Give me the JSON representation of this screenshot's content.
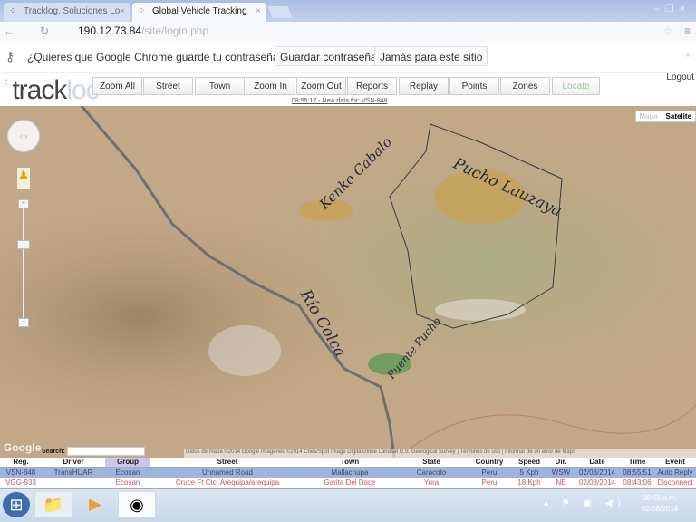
{
  "browser": {
    "tabs": [
      {
        "label": "Tracklog. Soluciones Lo"
      },
      {
        "label": "Global Vehicle Tracking"
      }
    ],
    "url_host": "190.12.73.84",
    "url_path": "/site/login.php",
    "infobar": {
      "question": "¿Quieres que Google Chrome guarde tu contraseña?",
      "save": "Guardar contraseña",
      "never": "Jamás para este sitio"
    }
  },
  "app": {
    "logo": "trackloc",
    "nav": [
      "Zoom All",
      "Street",
      "Town",
      "Zoom In",
      "Zoom Out",
      "Reports",
      "Replay",
      "Points",
      "Zones",
      "Locate"
    ],
    "logout": "Logout",
    "status": "08:55:17 - New data for: VSN-848"
  },
  "map": {
    "types": [
      "Mapa",
      "Satelite"
    ],
    "google": "Google",
    "search_label": "Search:",
    "copyright": "Datos de mapa ©2014 Google Imágenes ©2014 Cnes/Spot Image DigitalGlobe Landsat U.S. Geological Survey | Términos de uso | Informar de un error de Maps",
    "annotations": [
      "Kenko Cabalo",
      "Pucho Lauzaya",
      "Río Colca",
      "Puente Pucho"
    ]
  },
  "table": {
    "columns": [
      "Reg.",
      "Driver",
      "Group",
      "Street",
      "Town",
      "State",
      "Country",
      "Speed",
      "Dir.",
      "Date",
      "Time",
      "Event"
    ],
    "rows": [
      [
        "VSN-848",
        "TransHUAR",
        "Ecosan",
        "Unnamed Road",
        "Mallachupa",
        "Caracoto",
        "Peru",
        "5 Kph",
        "WSW",
        "02/08/2014",
        "08:55:51",
        "Auto Reply"
      ],
      [
        "VGG-933",
        "",
        "Ecosan",
        "Cruce Ft Ctc. Arequipa/arequipa",
        "Garita Del Doce",
        "Yura",
        "Peru",
        "18 Kph",
        "NE",
        "02/08/2014",
        "08:43:06",
        "Disconnect"
      ]
    ]
  },
  "taskbar": {
    "clock_time": "08:55 a.m.",
    "clock_date": "02/08/2014"
  }
}
